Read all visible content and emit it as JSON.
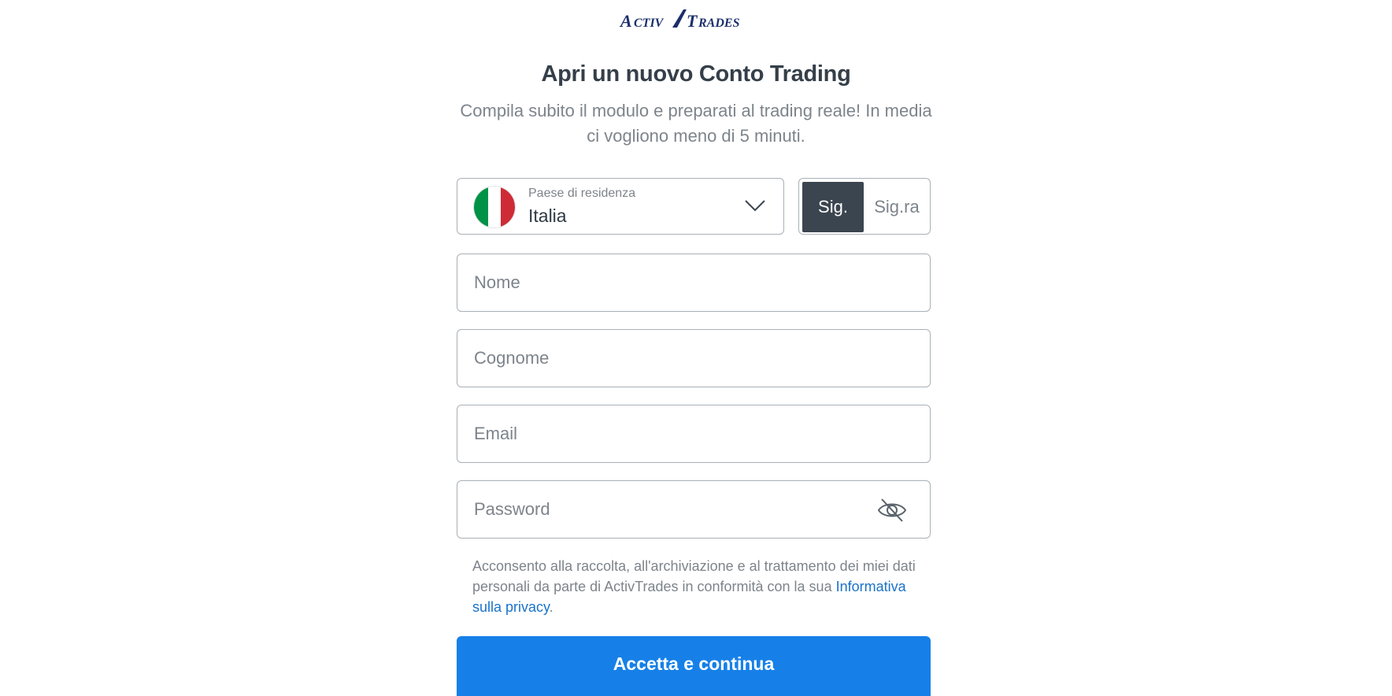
{
  "brand": {
    "logo_text": "ActivTrades",
    "color": "#1b2f6b"
  },
  "header": {
    "title": "Apri un nuovo Conto Trading",
    "subtitle": "Compila subito il modulo e preparati al trading reale! In media ci vogliono meno di 5 minuti."
  },
  "country": {
    "label": "Paese di residenza",
    "value": "Italia",
    "flag_icon": "italy-flag-icon",
    "chevron_icon": "chevron-down-icon"
  },
  "salutation": {
    "options": [
      "Sig.",
      "Sig.ra"
    ],
    "selected": "Sig."
  },
  "form": {
    "first_name": {
      "value": "",
      "placeholder": "Nome"
    },
    "last_name": {
      "value": "",
      "placeholder": "Cognome"
    },
    "email": {
      "value": "",
      "placeholder": "Email"
    },
    "password": {
      "value": "",
      "placeholder": "Password",
      "toggle_icon": "eye-slash-icon"
    }
  },
  "consent": {
    "text": "Acconsento alla raccolta, all'archiviazione e al trattamento dei miei dati personali da parte di ActivTrades in conformità con la sua ",
    "link_text": "Informativa sulla privacy",
    "suffix": "."
  },
  "submit": {
    "label": "Accetta e continua"
  },
  "colors": {
    "primary": "#1680e8",
    "link": "#1a73c9",
    "toggle_active": "#3b4550",
    "border": "#a9b0b7",
    "muted_text": "#7d848b"
  }
}
